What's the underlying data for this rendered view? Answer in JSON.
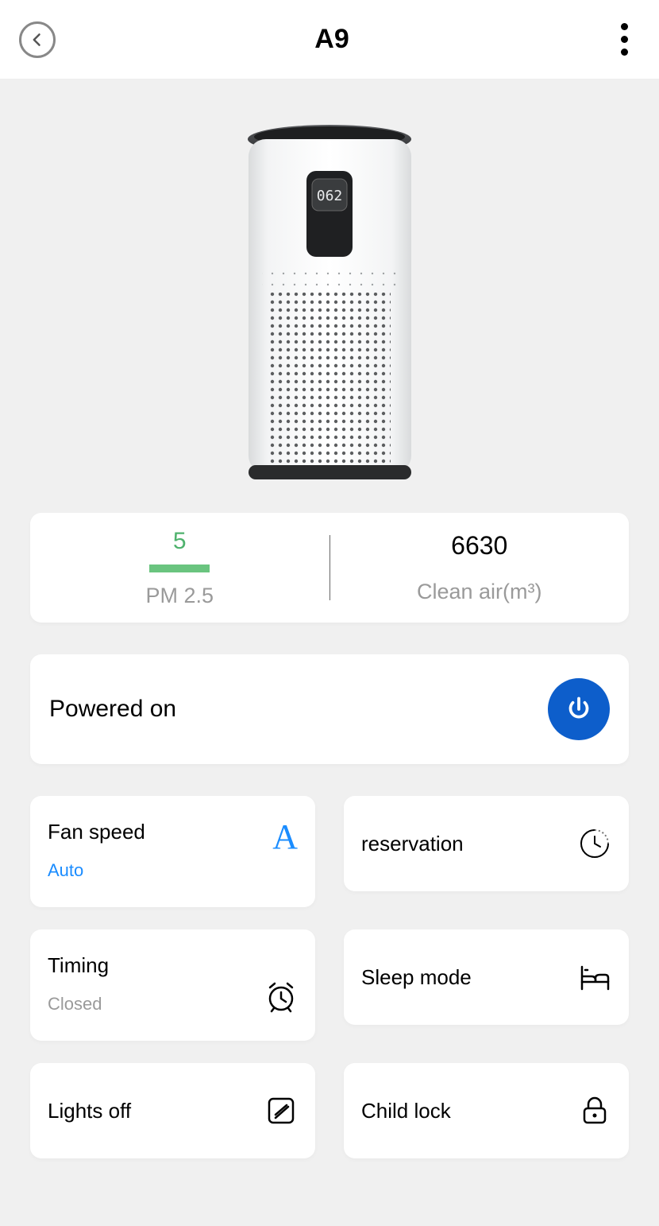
{
  "header": {
    "title": "A9"
  },
  "device": {
    "display_value": "062"
  },
  "stats": {
    "pm_value": "5",
    "pm_label": "PM 2.5",
    "clean_air_value": "6630",
    "clean_air_label": "Clean air(m³)"
  },
  "power": {
    "label": "Powered on"
  },
  "tiles": {
    "fan": {
      "title": "Fan speed",
      "sub": "Auto",
      "icon_letter": "A"
    },
    "reservation": {
      "title": "reservation"
    },
    "timing": {
      "title": "Timing",
      "sub": "Closed"
    },
    "sleep": {
      "title": "Sleep mode"
    },
    "lights": {
      "title": "Lights off"
    },
    "child": {
      "title": "Child lock"
    }
  }
}
